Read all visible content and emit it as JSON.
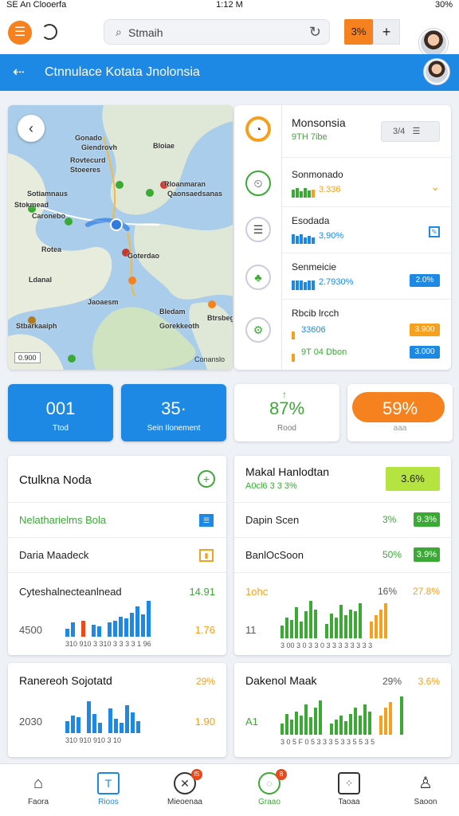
{
  "status": {
    "left": "SE An Clooerfa",
    "time": "1:12 M",
    "right": "30%"
  },
  "topbar": {
    "search_placeholder": "Stmaih",
    "pct_label": "3%",
    "plus_label": "+"
  },
  "titlebar": {
    "title": "Ctnnulace Kotata Jnolonsia"
  },
  "map": {
    "labels": [
      "Gonado",
      "Giendrovh",
      "Bloiae",
      "Rovtecurd",
      "Stoeeres",
      "Rloanmaran",
      "Qaonsaedsanas",
      "Sotiamnaus",
      "Stokmead",
      "Caronebo",
      "Goterdao",
      "Rotea",
      "Ldanal",
      "Jaoaesm",
      "Bledam",
      "Btrsbegoo",
      "Stbarkaaiph",
      "Gorekkeoth"
    ],
    "scale": "0.900",
    "credit": "Conanslo"
  },
  "right_panel": {
    "header": {
      "name": "Monsonsia",
      "value": "9TH 7ibe",
      "chip": "3/4"
    },
    "rows": [
      {
        "name": "Sonmonado",
        "value": "3.336"
      },
      {
        "name": "Esodada",
        "value": "3,90%",
        "tag": ""
      },
      {
        "name": "Senmeicie",
        "value": "2.7930%",
        "tag": "2.0%"
      },
      {
        "name": "Rbcib lrcch",
        "value": "33606",
        "value2": "9T 04 Dbon",
        "tag": "3.900",
        "tag2": "3.000"
      }
    ],
    "colors": {
      "green": "#3aaa35",
      "blue": "#1e88e5",
      "orange": "#f5a11f"
    }
  },
  "tiles": [
    {
      "big": "001",
      "small": "Ttod"
    },
    {
      "big": "35·",
      "small": "Sein Ilonement"
    },
    {
      "big": "87%",
      "small": "Rood"
    },
    {
      "big": "59%",
      "small": "aaa"
    }
  ],
  "card_left_top": {
    "title": "Ctulkna Noda",
    "rows": [
      {
        "label": "Nelatharielms Bola"
      },
      {
        "label": "Daria Maadeck"
      }
    ],
    "chart_title": "Cyteshalnecteanlnead",
    "chart_value": "14.91",
    "axis_left": "4500",
    "axis_right": "1.76",
    "ticks": "310   910   3 310   3 3 3 3   1 96"
  },
  "card_right_top": {
    "title": "Makal Hanlodtan",
    "subtitle": "A0cl6 3 3 3%",
    "badge": "3.6%",
    "rows": [
      {
        "label": "Dapin Scen",
        "pct": "3%",
        "badge": "9.3%"
      },
      {
        "label": "BanlOcSoon",
        "pct": "50%",
        "badge": "3.9%"
      }
    ],
    "chart_title": "1ohc",
    "chart_pct1": "16%",
    "chart_pct2": "27.8%",
    "axis_left": "11",
    "ticks": "3 00   3 0 3   3 0 3 3   3 3 3   3 3 3"
  },
  "card_left_bottom": {
    "title": "Ranereoh Sojotatd",
    "pct": "29%",
    "axis_left": "2030",
    "axis_right": "1.90",
    "ticks": "310   910   910   3 10"
  },
  "card_right_bottom": {
    "title": "Dakenol Maak",
    "pct1": "29%",
    "pct2": "3.6%",
    "axis_left": "A1",
    "ticks": "3 0 5   F 0 5   3 3 3 5   3 3 5   5 3 5"
  },
  "bottom_nav": [
    {
      "label": "Faora",
      "icon": "home-icon"
    },
    {
      "label": "Rioos",
      "icon": "calendar-icon"
    },
    {
      "label": "Mieoenaa",
      "icon": "tools-icon",
      "badge": "f5"
    },
    {
      "label": "Graao",
      "icon": "chat-icon",
      "badge": "8"
    },
    {
      "label": "Taoaa",
      "icon": "grid-icon"
    },
    {
      "label": "Saoon",
      "icon": "user-icon"
    }
  ]
}
